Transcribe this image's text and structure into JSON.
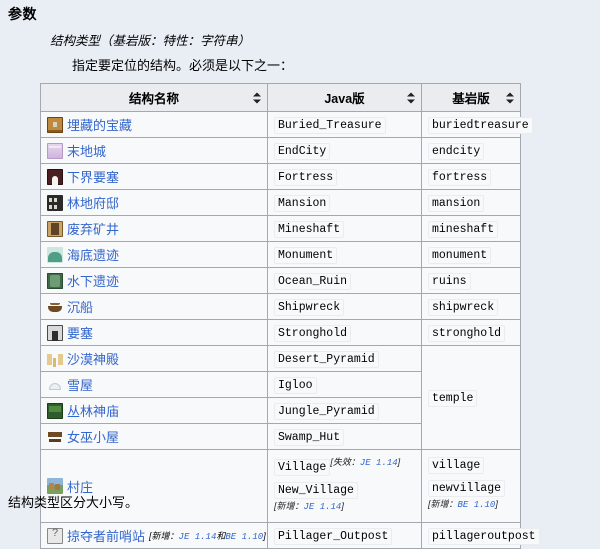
{
  "page": {
    "section_heading": "参数",
    "param_signature": "结构类型（基岩版：特性：字符串）",
    "description": "指定要定位的结构。必须是以下之一：",
    "footer_note": "结构类型区分大小写。",
    "link_color": "#3366cc",
    "background_color": "#e9eef5",
    "table_header_bg": "#eaecf0",
    "table_border_color": "#a2a9b1"
  },
  "table": {
    "columns": [
      {
        "label": "结构名称",
        "sort_icon": "sort-arrows-icon"
      },
      {
        "label": "Java版",
        "sort_icon": "sort-arrows-icon"
      },
      {
        "label": "基岩版",
        "sort_icon": "sort-arrows-icon"
      }
    ],
    "rows": [
      {
        "icon": "buried-treasure-icon",
        "name": "埋藏的宝藏",
        "java": "Buried_Treasure",
        "bedrock": "buriedtreasure"
      },
      {
        "icon": "end-city-icon",
        "name": "末地城",
        "java": "EndCity",
        "bedrock": "endcity"
      },
      {
        "icon": "nether-fortress-icon",
        "name": "下界要塞",
        "java": "Fortress",
        "bedrock": "fortress"
      },
      {
        "icon": "woodland-mansion-icon",
        "name": "林地府邸",
        "java": "Mansion",
        "bedrock": "mansion"
      },
      {
        "icon": "mineshaft-icon",
        "name": "废弃矿井",
        "java": "Mineshaft",
        "bedrock": "mineshaft"
      },
      {
        "icon": "ocean-monument-icon",
        "name": "海底遗迹",
        "java": "Monument",
        "bedrock": "monument"
      },
      {
        "icon": "ocean-ruin-icon",
        "name": "水下遗迹",
        "java": "Ocean_Ruin",
        "bedrock": "ruins"
      },
      {
        "icon": "shipwreck-icon",
        "name": "沉船",
        "java": "Shipwreck",
        "bedrock": "shipwreck"
      },
      {
        "icon": "stronghold-icon",
        "name": "要塞",
        "java": "Stronghold",
        "bedrock": "stronghold"
      },
      {
        "icon": "desert-pyramid-icon",
        "name": "沙漠神殿",
        "java": "Desert_Pyramid",
        "bedrock": "temple"
      },
      {
        "icon": "igloo-icon",
        "name": "雪屋",
        "java": "Igloo",
        "bedrock": ""
      },
      {
        "icon": "jungle-pyramid-icon",
        "name": "丛林神庙",
        "java": "Jungle_Pyramid",
        "bedrock": ""
      },
      {
        "icon": "swamp-hut-icon",
        "name": "女巫小屋",
        "java": "Swamp_Hut",
        "bedrock": ""
      }
    ],
    "temple_merged_value": "temple",
    "village_row": {
      "icon": "village-icon",
      "name": "村庄",
      "java_entries": [
        {
          "code": "Village",
          "note_label": "失效：",
          "note_version": "JE 1.14"
        },
        {
          "code": "New_Village",
          "note_label": "新增：",
          "note_version": "JE 1.14"
        }
      ],
      "bedrock_entries": [
        {
          "code": "village",
          "note_label": "",
          "note_version": ""
        },
        {
          "code": "newvillage",
          "note_label": "新增：",
          "note_version": "BE 1.10"
        }
      ]
    },
    "outpost_row": {
      "icon": "pillager-outpost-icon",
      "name": "掠夺者前哨站",
      "note_label": "新增：",
      "note_version_java": "JE 1.14",
      "note_conjunction": "和",
      "note_version_bedrock": "BE 1.10",
      "java": "Pillager_Outpost",
      "bedrock": "pillageroutpost"
    }
  }
}
